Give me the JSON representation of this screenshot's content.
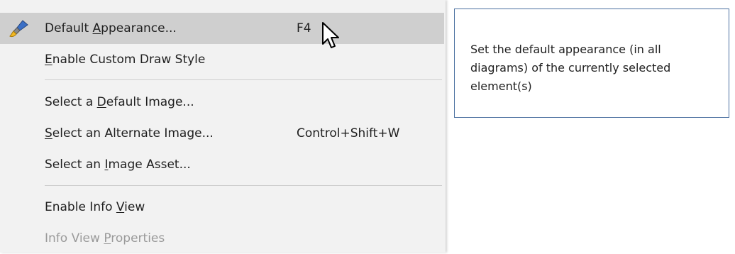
{
  "menu": {
    "items": [
      {
        "pre": "Default ",
        "acc": "A",
        "post": "ppearance...",
        "shortcut": "F4",
        "icon": "brush-icon",
        "state": "highlighted"
      },
      {
        "pre": "",
        "acc": "E",
        "post": "nable Custom Draw Style",
        "shortcut": "",
        "state": "enabled"
      },
      {
        "pre": "Select a ",
        "acc": "D",
        "post": "efault Image...",
        "shortcut": "",
        "state": "enabled"
      },
      {
        "pre": "",
        "acc": "S",
        "post": "elect an Alternate Image...",
        "shortcut": "Control+Shift+W",
        "state": "enabled"
      },
      {
        "pre": "Select an ",
        "acc": "I",
        "post": "mage Asset...",
        "shortcut": "",
        "state": "enabled"
      },
      {
        "pre": "Enable Info ",
        "acc": "V",
        "post": "iew",
        "shortcut": "",
        "state": "enabled"
      },
      {
        "pre": "Info View ",
        "acc": "P",
        "post": "roperties",
        "shortcut": "",
        "state": "disabled"
      }
    ]
  },
  "tooltip": {
    "text": "Set the default appearance (in all diagrams) of the currently selected element(s)"
  },
  "colors": {
    "highlight": "#cfcfcf",
    "menu_bg": "#f2f2f2",
    "tooltip_border": "#4a6fa0",
    "disabled_text": "#9a9a9a"
  }
}
